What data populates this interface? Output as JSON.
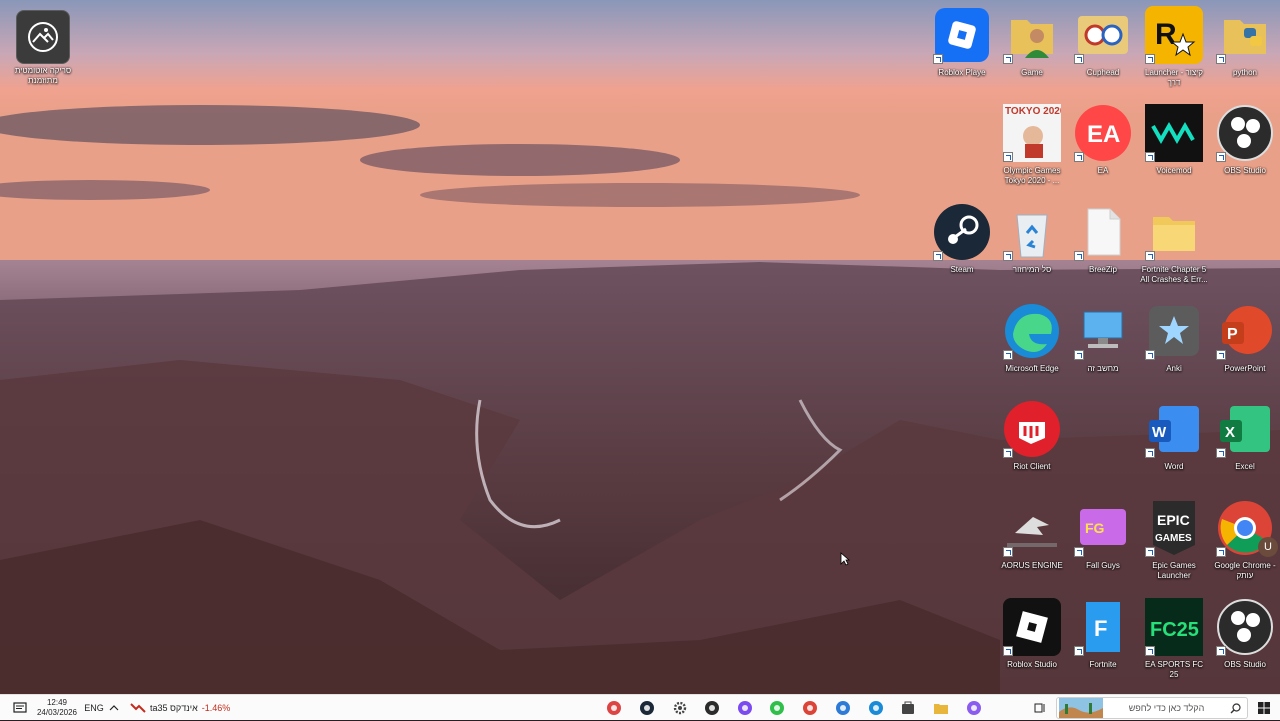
{
  "desktop": {
    "icons_left": [
      {
        "name": "photos-app",
        "label": "סריקה אוטומטית מתוזמנת"
      }
    ],
    "icons_grid": [
      {
        "name": "roblox-player",
        "label": "Roblox Playe",
        "icon": "roblox-icon"
      },
      {
        "name": "game-folder",
        "label": "Game",
        "icon": "folder-person-icon"
      },
      {
        "name": "cuphead",
        "label": "Cuphead",
        "icon": "cuphead-icon"
      },
      {
        "name": "rockstar-launcher",
        "label": "Launcher - קיצור דרך",
        "icon": "rockstar-icon"
      },
      {
        "name": "python-folder",
        "label": "python",
        "icon": "folder-python-icon"
      },
      {
        "name": "olympic-games",
        "label": "Olympic Games Tokyo 2020 - ...",
        "icon": "tokyo-icon"
      },
      {
        "name": "ea-app",
        "label": "EA",
        "icon": "ea-icon"
      },
      {
        "name": "voicemod",
        "label": "Voicemod",
        "icon": "voicemod-icon"
      },
      {
        "name": "obs-studio-1",
        "label": "OBS Studio",
        "icon": "obs-icon"
      },
      {
        "name": "steam",
        "label": "Steam",
        "icon": "steam-icon"
      },
      {
        "name": "recycle-bin",
        "label": "סל המיחזור",
        "icon": "recycle-bin-icon"
      },
      {
        "name": "breezip",
        "label": "BreeZip",
        "icon": "file-icon"
      },
      {
        "name": "fortnite-crashes-folder",
        "label": "Fortnite Chapter 5 All Crashes & Err...",
        "icon": "folder-icon"
      },
      {
        "name": "microsoft-edge",
        "label": "Microsoft Edge",
        "icon": "edge-icon"
      },
      {
        "name": "this-pc",
        "label": "מחשב זה",
        "icon": "computer-icon"
      },
      {
        "name": "anki",
        "label": "Anki",
        "icon": "anki-icon"
      },
      {
        "name": "powerpoint",
        "label": "PowerPoint",
        "icon": "powerpoint-icon"
      },
      {
        "name": "riot-client",
        "label": "Riot Client",
        "icon": "riot-icon"
      },
      {
        "name": "word",
        "label": "Word",
        "icon": "word-icon"
      },
      {
        "name": "excel",
        "label": "Excel",
        "icon": "excel-icon"
      },
      {
        "name": "aorus-engine",
        "label": "AORUS ENGINE",
        "icon": "aorus-icon"
      },
      {
        "name": "fall-guys",
        "label": "Fall Guys",
        "icon": "fallguys-icon"
      },
      {
        "name": "epic-games",
        "label": "Epic Games Launcher",
        "icon": "epic-icon"
      },
      {
        "name": "google-chrome",
        "label": "Google Chrome - עותק",
        "icon": "chrome-icon"
      },
      {
        "name": "roblox-studio",
        "label": "Roblox Studio",
        "icon": "roblox-studio-icon"
      },
      {
        "name": "fortnite",
        "label": "Fortnite",
        "icon": "fortnite-icon"
      },
      {
        "name": "ea-sports-fc25",
        "label": "EA SPORTS FC 25",
        "icon": "fc25-icon"
      },
      {
        "name": "obs-studio-2",
        "label": "OBS Studio",
        "icon": "obs-icon"
      }
    ],
    "chrome_badge": "U"
  },
  "taskbar": {
    "clock_time": "12:49",
    "clock_date": "24/03/2026",
    "language": "ENG",
    "stock_name": "ta35 אינדקס",
    "stock_change": "-1.46%",
    "search_placeholder": "הקלד כאן כדי לחפש",
    "pinned": [
      "chrome-like-icon",
      "steam-icon",
      "settings-icon",
      "epic-icon",
      "messenger-icon",
      "razer-icon",
      "chrome-icon",
      "photos-icon",
      "edge-icon",
      "store-icon",
      "explorer-icon",
      "copilot-icon"
    ],
    "colors": {
      "accent": "#0078d4",
      "negative": "#c42b1c"
    }
  }
}
